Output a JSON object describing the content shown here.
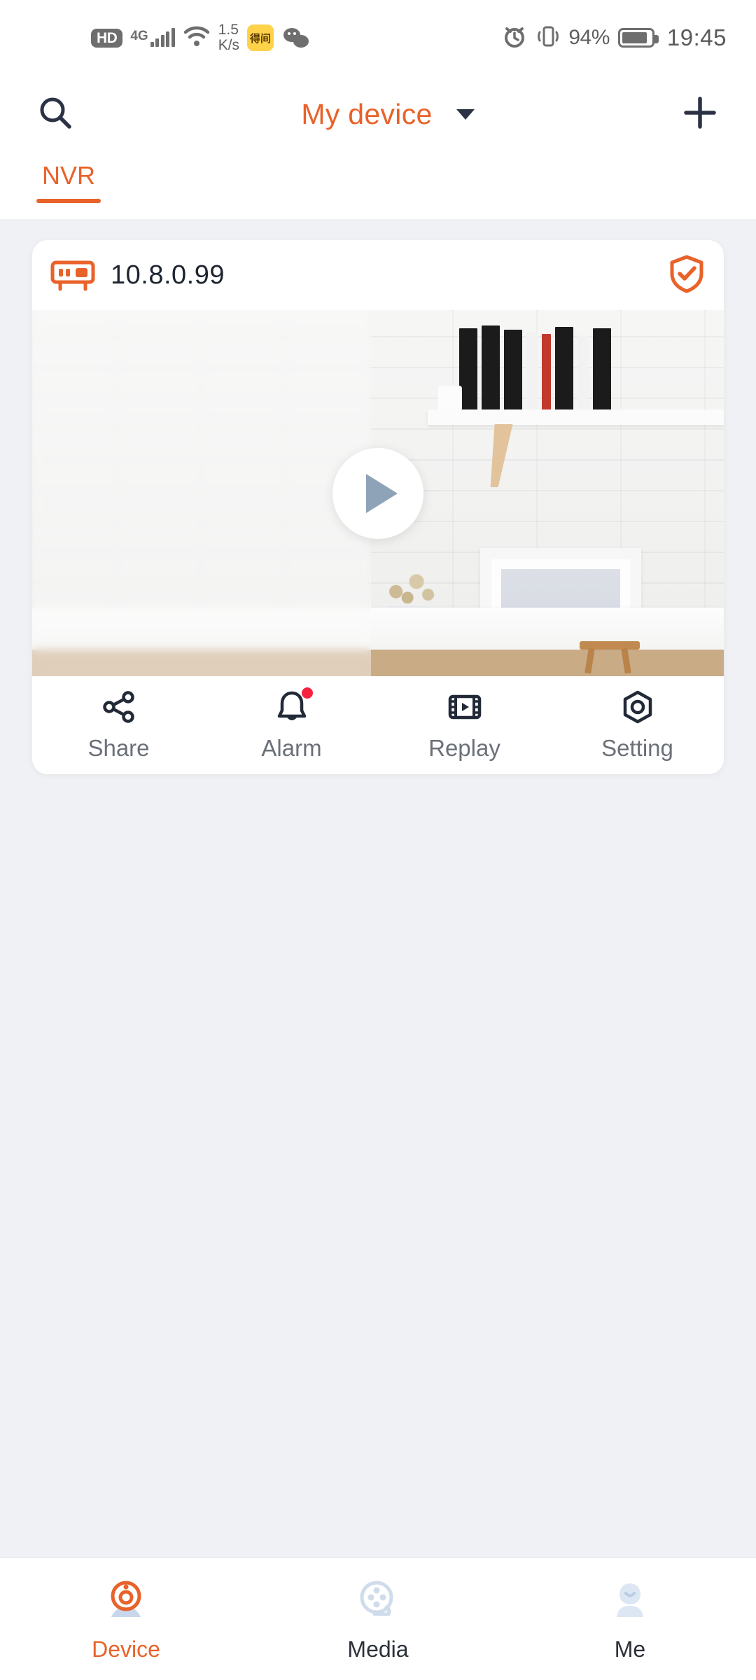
{
  "statusbar": {
    "hd_badge": "HD",
    "network_type": "4G",
    "net_speed_value": "1.5",
    "net_speed_unit": "K/s",
    "app_badge_label": "得间",
    "battery_percent": "94%",
    "time": "19:45",
    "icons": [
      "hd-icon",
      "signal-bars-icon",
      "wifi-icon",
      "app-badge-icon",
      "wechat-icon",
      "alarm-clock-icon",
      "vibrate-icon",
      "battery-icon"
    ]
  },
  "header": {
    "title": "My device",
    "search_icon": "search-icon",
    "dropdown_icon": "chevron-down-icon",
    "add_icon": "plus-icon",
    "accent_color": "#e8622a"
  },
  "tabs": [
    {
      "label": "NVR",
      "active": true
    }
  ],
  "device_card": {
    "ip": "10.8.0.99",
    "device_icon": "nvr-device-icon",
    "status_icon": "shield-check-icon",
    "status_color": "#e8622a",
    "play_icon": "play-icon",
    "actions": [
      {
        "label": "Share",
        "icon": "share-icon",
        "badge": false
      },
      {
        "label": "Alarm",
        "icon": "bell-icon",
        "badge": true
      },
      {
        "label": "Replay",
        "icon": "film-play-icon",
        "badge": false
      },
      {
        "label": "Setting",
        "icon": "gear-hex-icon",
        "badge": false
      }
    ]
  },
  "bottom_nav": [
    {
      "label": "Device",
      "icon": "camera-icon",
      "active": true
    },
    {
      "label": "Media",
      "icon": "film-reel-icon",
      "active": false
    },
    {
      "label": "Me",
      "icon": "person-icon",
      "active": false
    }
  ]
}
